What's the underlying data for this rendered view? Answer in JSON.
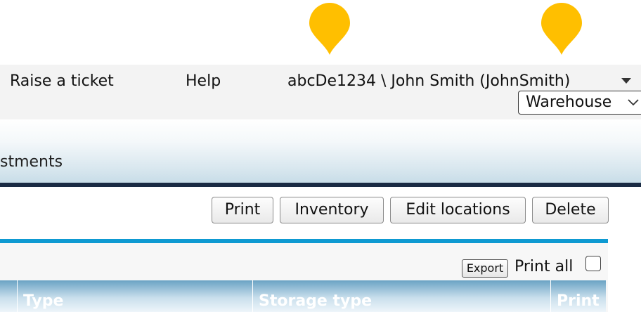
{
  "header": {
    "links": [
      "Raise a ticket",
      "Help"
    ],
    "user_label": "abcDe1234 \\ John Smith (JohnSmith)",
    "warehouse_select": "Warehouse"
  },
  "tabs": {
    "visible_label": "stments"
  },
  "toolbar": {
    "print_label": "Print",
    "inventory_label": "Inventory",
    "edit_locations_label": "Edit locations",
    "delete_label": "Delete"
  },
  "panel": {
    "export_label": "Export",
    "print_all_label": "Print all"
  },
  "table": {
    "columns": [
      "Type",
      "Storage type",
      "Print"
    ]
  },
  "colors": {
    "pin": "#ffbf00",
    "header_bg": "#f3f3f3",
    "accent_line": "#0e9ad2",
    "dark_line": "#1a2b44"
  },
  "icons": [
    "map-pin-icon",
    "caret-down-icon",
    "chevron-down-icon"
  ]
}
